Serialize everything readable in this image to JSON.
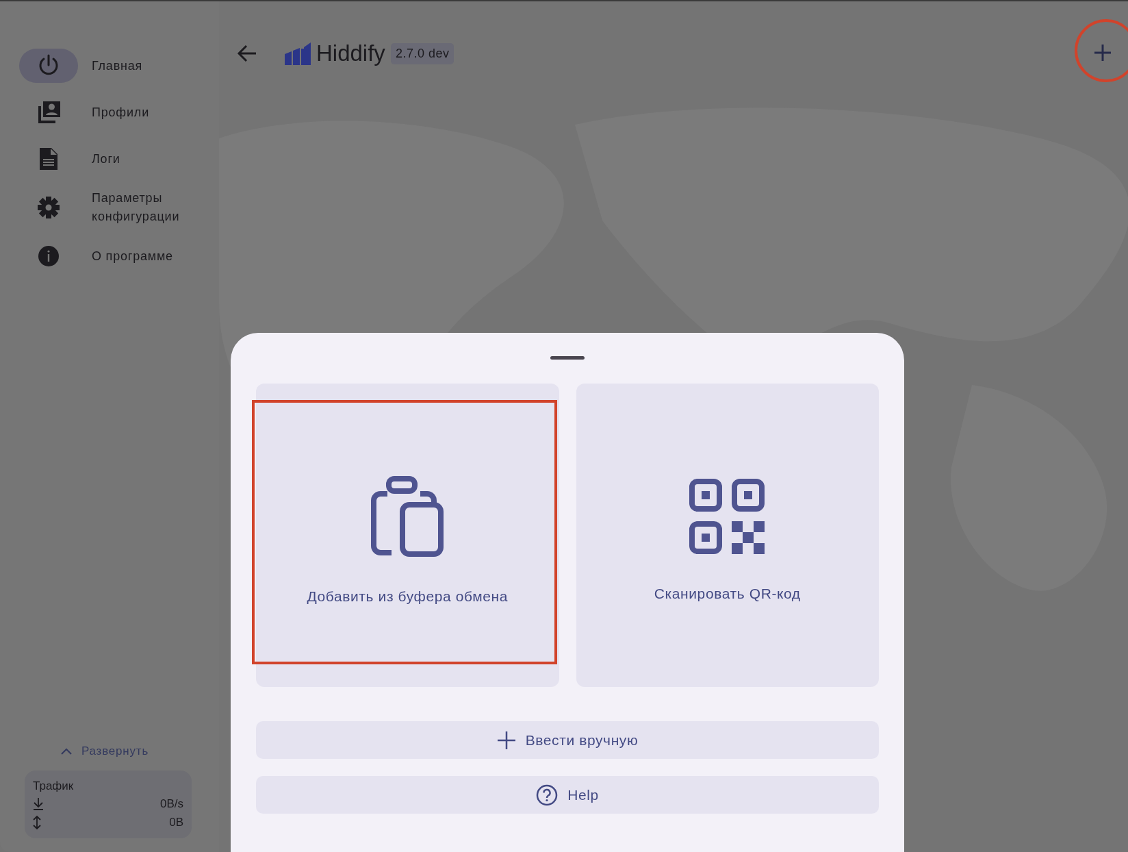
{
  "sidebar": {
    "items": [
      {
        "kind": "power",
        "label": "Главная",
        "selected": true
      },
      {
        "kind": "profiles",
        "label": "Профили",
        "selected": false
      },
      {
        "kind": "document",
        "label": "Логи",
        "selected": false
      },
      {
        "kind": "gear",
        "label": "Параметры конфигурации",
        "selected": false
      },
      {
        "kind": "info",
        "label": "О программе",
        "selected": false
      }
    ],
    "expand_label": "Развернуть",
    "traffic": {
      "title": "Трафик",
      "rows": [
        {
          "kind": "download",
          "value": "0B/s"
        },
        {
          "kind": "updown",
          "value": "0B"
        }
      ]
    }
  },
  "header": {
    "app_name": "Hiddify",
    "version": "2.7.0 dev"
  },
  "sheet": {
    "cards": [
      {
        "kind": "clipboard",
        "label": "Добавить из буфера обмена",
        "highlighted": true
      },
      {
        "kind": "qr",
        "label": "Сканировать QR-код",
        "highlighted": false
      }
    ],
    "buttons": [
      {
        "kind": "plus",
        "label": "Ввести вручную"
      },
      {
        "kind": "help",
        "label": "Help"
      }
    ]
  }
}
